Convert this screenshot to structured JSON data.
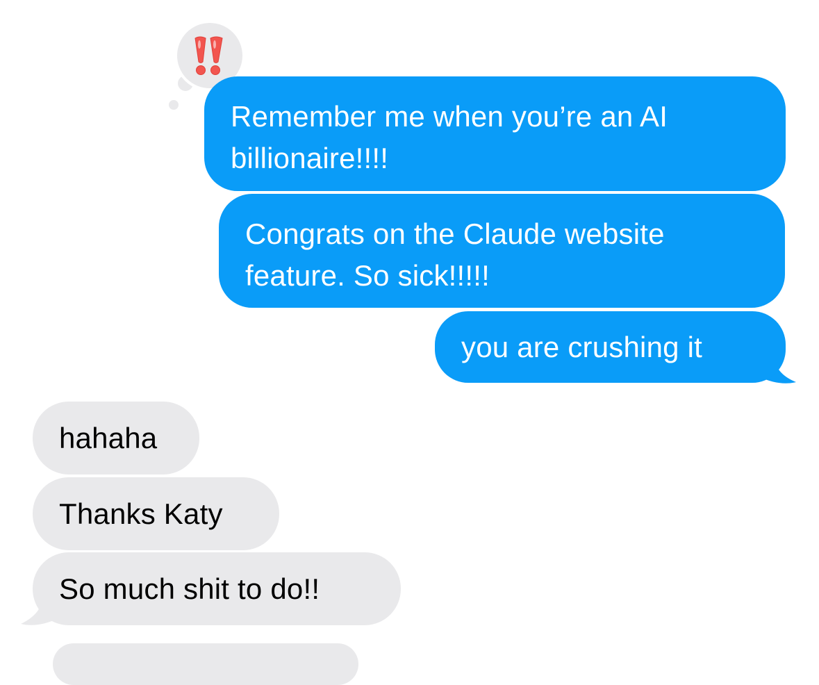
{
  "conversation": {
    "tapback": {
      "icon": "double-exclamation-icon",
      "color": "#f2554f",
      "on_message_index": 0
    },
    "sent_color": "#0a9cf8",
    "received_color": "#e9e9eb",
    "messages": [
      {
        "direction": "sent",
        "lines": [
          "Remember me when you’re an AI",
          "billionaire!!!!"
        ]
      },
      {
        "direction": "sent",
        "lines": [
          "Congrats on the Claude website",
          "feature. So sick!!!!!"
        ]
      },
      {
        "direction": "sent",
        "lines": [
          "you are crushing it"
        ]
      },
      {
        "direction": "received",
        "lines": [
          "hahaha"
        ]
      },
      {
        "direction": "received",
        "lines": [
          "Thanks Katy"
        ]
      },
      {
        "direction": "received",
        "lines": [
          "So much shit to do!!"
        ]
      }
    ]
  }
}
